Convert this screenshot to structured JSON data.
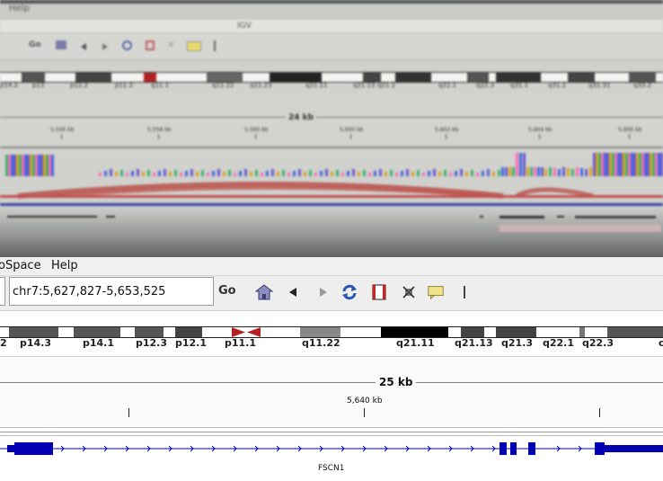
{
  "photo": {
    "menu_help": "Help",
    "window_title": "IGV",
    "go_label": "Go",
    "band_labels": [
      "p14.2",
      "p13",
      "p12.2",
      "p11.2",
      "q11.1",
      "q11.22",
      "q11.23",
      "q21.11",
      "q21.13",
      "q21.2",
      "q22.1",
      "q22.3",
      "q31.1",
      "q31.2",
      "q31.31",
      "q33.2"
    ],
    "scale_label": "24 kb",
    "tick_labels": [
      "5,556 kb",
      "5,558 kb",
      "5,560 kb",
      "5,600 kb",
      "5,602 kb",
      "5,604 kb",
      "5,606 kb"
    ]
  },
  "menubar": {
    "items": [
      "oSpace",
      "Help"
    ]
  },
  "toolbar": {
    "locus_value": "chr7:5,627,827-5,653,525",
    "go_label": "Go",
    "icons": [
      "home-icon",
      "back-arrow-icon",
      "forward-arrow-icon",
      "refresh-icon",
      "roi-icon",
      "resize-icon",
      "popup-text-icon",
      "separator-icon"
    ]
  },
  "ideogram": {
    "band_labels": [
      "2",
      "p14.3",
      "p14.1",
      "p12.3",
      "p12.1",
      "p11.1",
      "q11.22",
      "q21.11",
      "q21.13",
      "q21.3",
      "q22.1",
      "q22.3",
      "c"
    ]
  },
  "ruler": {
    "scale_label": "25 kb",
    "coordinate_label": "5,640 kb"
  },
  "gene_track": {
    "gene_name": "FSCN1",
    "color": "#0000b2"
  },
  "colors": {
    "centromere": "#b22222",
    "gene": "#0000b2",
    "coverage_bars": [
      "#6a5acd",
      "#daa520",
      "#3cb371",
      "#ff69b4",
      "#4169e1"
    ],
    "arc": "#b5403a"
  }
}
